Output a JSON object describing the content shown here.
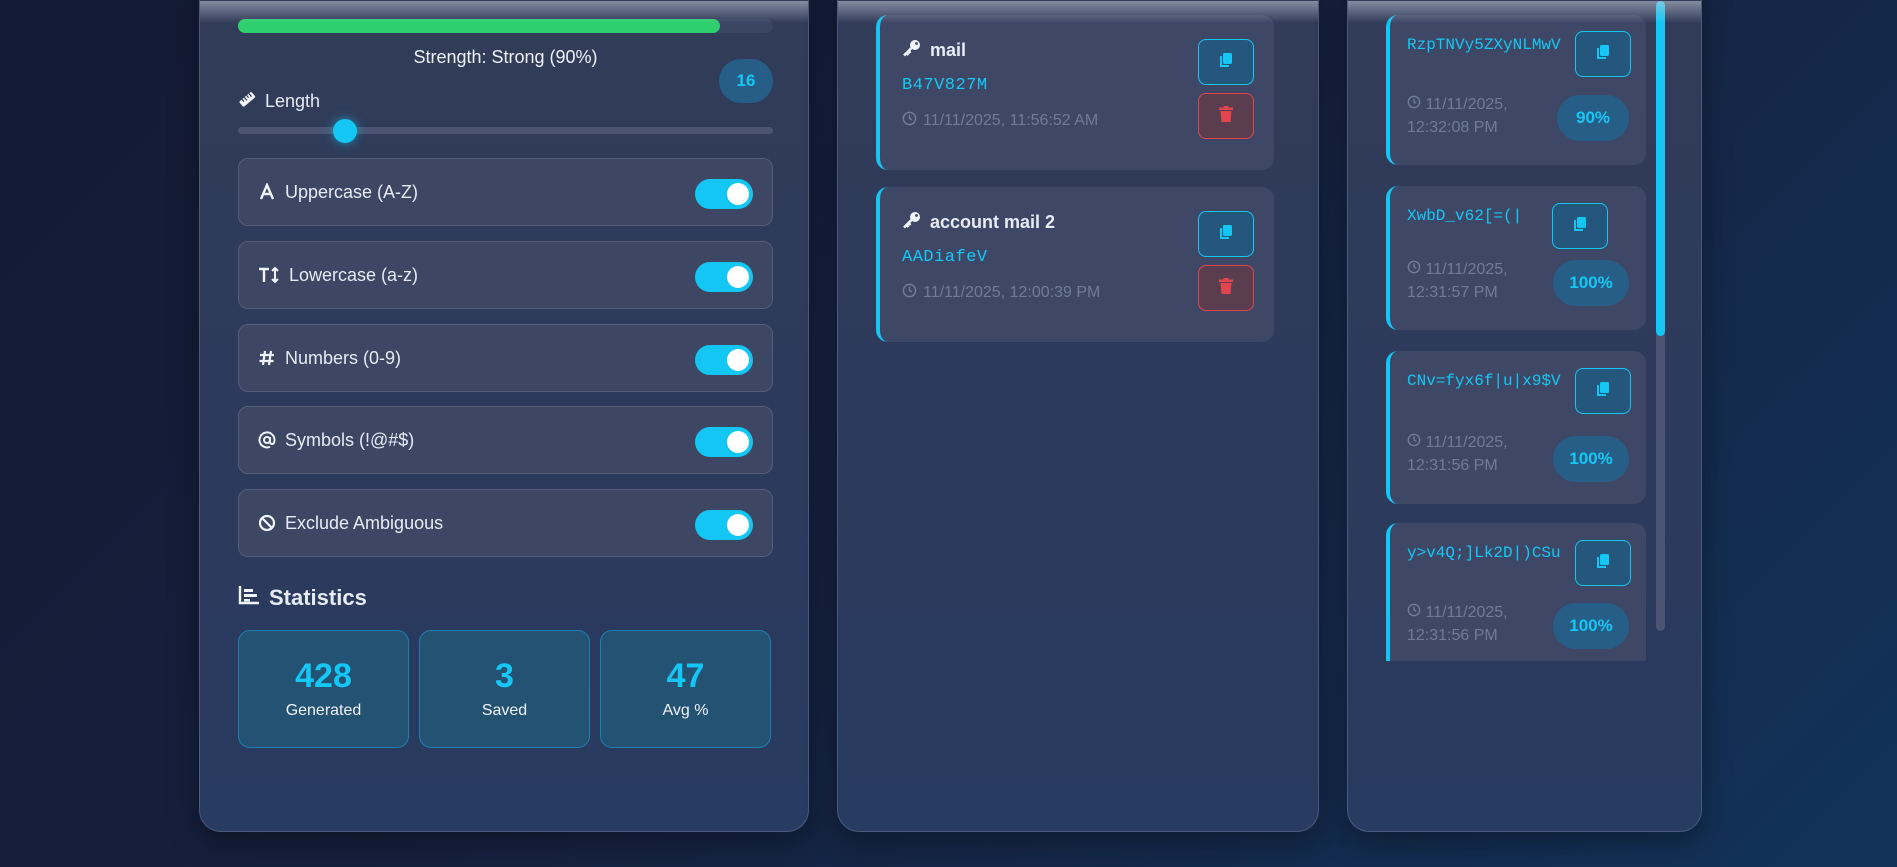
{
  "generator": {
    "strength_text": "Strength: Strong (90%)",
    "strength_percent": 90,
    "length_label": "Length",
    "length_value": "16",
    "length_min": 4,
    "length_max": 64,
    "options": [
      {
        "label": "Uppercase (A-Z)",
        "icon": "letter-a-icon",
        "enabled": true
      },
      {
        "label": "Lowercase (a-z)",
        "icon": "text-height-icon",
        "enabled": true
      },
      {
        "label": "Numbers (0-9)",
        "icon": "hashtag-icon",
        "enabled": true
      },
      {
        "label": "Symbols (!@#$)",
        "icon": "at-icon",
        "enabled": true
      },
      {
        "label": "Exclude Ambiguous",
        "icon": "ban-icon",
        "enabled": true
      }
    ],
    "stats_title": "Statistics",
    "stats": [
      {
        "value": "428",
        "label": "Generated"
      },
      {
        "value": "3",
        "label": "Saved"
      },
      {
        "value": "47",
        "label": "Avg %"
      }
    ]
  },
  "saved": [
    {
      "name": "mail",
      "password": "B47V827M",
      "date": "11/11/2025, 11:56:52 AM"
    },
    {
      "name": "account mail 2",
      "password": "AADiafeV",
      "date": "11/11/2025, 12:00:39 PM"
    }
  ],
  "history": [
    {
      "password": "RzpTNVy5ZXyNLMwV",
      "date": "11/11/2025, 12:32:08 PM",
      "strength": "90%"
    },
    {
      "password": "XwbD_v62[=(|",
      "date": "11/11/2025, 12:31:57 PM",
      "strength": "100%"
    },
    {
      "password": "CNv=fyx6f|u|x9$V",
      "date": "11/11/2025, 12:31:56 PM",
      "strength": "100%"
    },
    {
      "password": "y>v4Q;]Lk2D|)CSu",
      "date": "11/11/2025, 12:31:56 PM",
      "strength": "100%"
    }
  ],
  "colors": {
    "accent": "#13c6f3",
    "success": "#2ecf6e",
    "danger": "#e2454f"
  }
}
